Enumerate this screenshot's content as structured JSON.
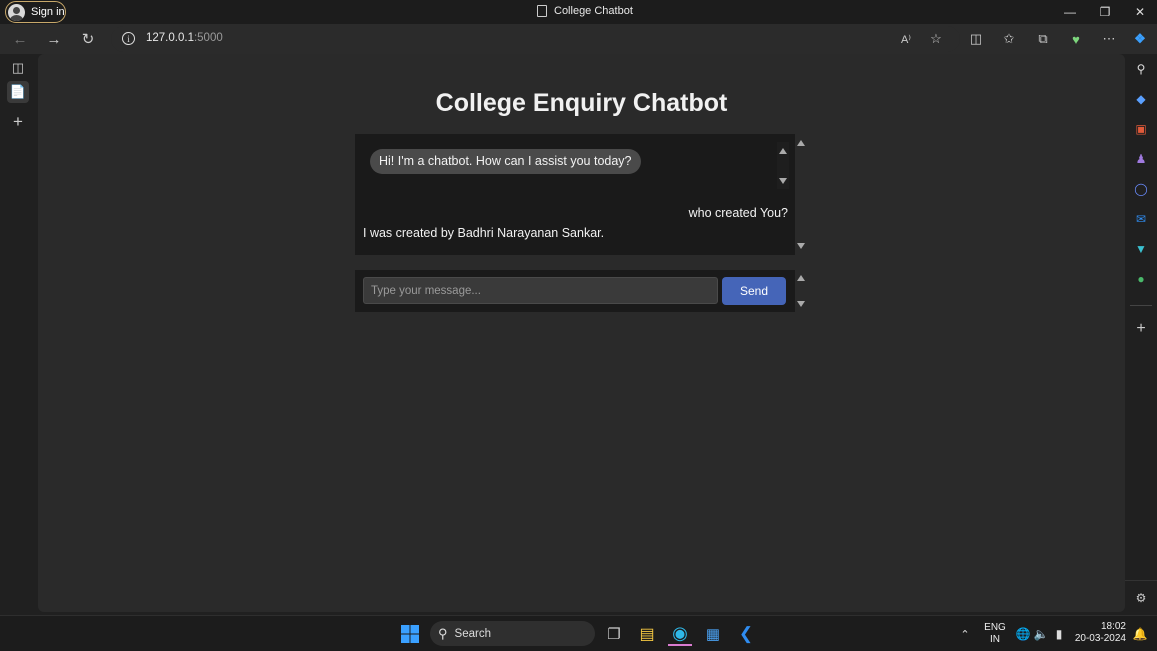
{
  "browser": {
    "signin_label": "Sign in",
    "tab_title": "College Chatbot",
    "url_host": "127.0.0.1",
    "url_port": ":5000"
  },
  "page": {
    "title": "College Enquiry Chatbot",
    "messages": [
      {
        "from": "bot",
        "text": "Hi! I'm a chatbot. How can I assist you today?"
      },
      {
        "from": "user",
        "text": "who created You?"
      },
      {
        "from": "bot",
        "text": "I was created by Badhri Narayanan Sankar."
      }
    ],
    "input_placeholder": "Type your message...",
    "send_label": "Send"
  },
  "taskbar": {
    "search_label": "Search",
    "lang_top": "ENG",
    "lang_bottom": "IN",
    "time": "18:02",
    "date": "20-03-2024"
  },
  "colors": {
    "accent_send": "#4565b8",
    "page_bg": "#2a2a2a",
    "chat_bg": "#1a1a1a"
  }
}
